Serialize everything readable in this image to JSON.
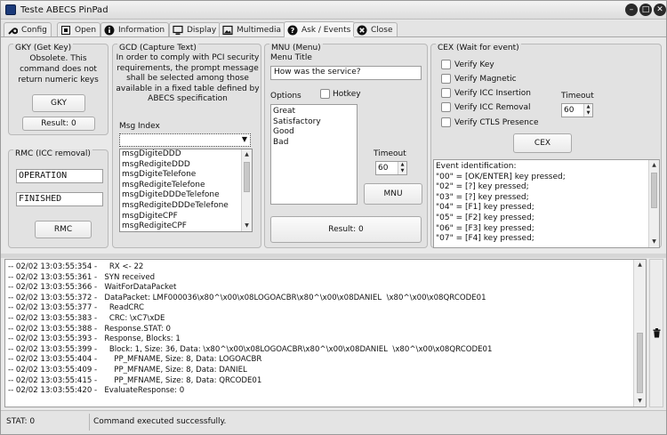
{
  "window": {
    "title": "Teste ABECS PinPad"
  },
  "tabs": [
    {
      "label": "Config",
      "icon": "wrench-icon"
    },
    {
      "label": "Open",
      "icon": "open-port-icon"
    },
    {
      "label": "Information",
      "icon": "info-icon"
    },
    {
      "label": "Display",
      "icon": "monitor-icon"
    },
    {
      "label": "Multimedia",
      "icon": "image-icon"
    },
    {
      "label": "Ask / Events",
      "icon": "help-icon",
      "active": true
    },
    {
      "label": "Close",
      "icon": "close-circle-icon"
    }
  ],
  "gky": {
    "title": "GKY (Get Key)",
    "description": "Obsolete. This command does not return numeric keys",
    "button": "GKY",
    "result": "Result: 0"
  },
  "rmc": {
    "title": "RMC (ICC removal)",
    "line1": "OPERATION",
    "line2": "FINISHED",
    "button": "RMC"
  },
  "gcd": {
    "title": "GCD (Capture Text)",
    "description": "In order to comply with PCI security requirements, the prompt message shall be selected among those available in a fixed table defined by ABECS specification",
    "msg_index_label": "Msg Index",
    "msg_items": [
      "msgDigiteDDD",
      "msgRedigiteDDD",
      "msgDigiteTelefone",
      "msgRedigiteTelefone",
      "msgDigiteDDDeTelefone",
      "msgRedigiteDDDeTelefone",
      "msgDigiteCPF",
      "msgRedigiteCPF"
    ]
  },
  "mnu": {
    "title": "MNU (Menu)",
    "menu_title_label": "Menu Title",
    "menu_title_value": "How was the service?",
    "options_label": "Options",
    "hotkey_label": "Hotkey",
    "options": [
      "Great",
      "Satisfactory",
      "Good",
      "Bad"
    ],
    "timeout_label": "Timeout",
    "timeout_value": "60",
    "button": "MNU",
    "result": "Result: 0"
  },
  "cex": {
    "title": "CEX (Wait for event)",
    "checks": [
      "Verify Key",
      "Verify Magnetic",
      "Verify ICC Insertion",
      "Verify ICC Removal",
      "Verify CTLS Presence"
    ],
    "timeout_label": "Timeout",
    "timeout_value": "60",
    "button": "CEX",
    "events": [
      "Event identification:",
      "\"00\" = [OK/ENTER] key pressed;",
      "\"02\" = [?] key pressed;",
      "\"03\" = [?] key pressed;",
      "\"04\" = [F1] key pressed;",
      "\"05\" = [F2] key pressed;",
      "\"06\" = [F3] key pressed;",
      "\"07\" = [F4] key pressed;"
    ]
  },
  "log": {
    "lines": [
      "-- 02/02 13:03:55:354 -     RX <- 22",
      "-- 02/02 13:03:55:361 -   SYN received",
      "-- 02/02 13:03:55:366 -   WaitForDataPacket",
      "-- 02/02 13:03:55:372 -   DataPacket: LMF000036\\x80^\\x00\\x08LOGOACBR\\x80^\\x00\\x08DANIEL  \\x80^\\x00\\x08QRCODE01",
      "-- 02/02 13:03:55:377 -     ReadCRC",
      "-- 02/02 13:03:55:383 -     CRC: \\xC7\\xDE",
      "-- 02/02 13:03:55:388 -   Response.STAT: 0",
      "-- 02/02 13:03:55:393 -   Response, Blocks: 1",
      "-- 02/02 13:03:55:399 -     Block: 1, Size: 36, Data: \\x80^\\x00\\x08LOGOACBR\\x80^\\x00\\x08DANIEL  \\x80^\\x00\\x08QRCODE01",
      "-- 02/02 13:03:55:404 -       PP_MFNAME, Size: 8, Data: LOGOACBR",
      "-- 02/02 13:03:55:409 -       PP_MFNAME, Size: 8, Data: DANIEL",
      "-- 02/02 13:03:55:415 -       PP_MFNAME, Size: 8, Data: QRCODE01",
      "-- 02/02 13:03:55:420 -   EvaluateResponse: 0"
    ]
  },
  "status": {
    "stat": "STAT: 0",
    "message": "Command executed successfully."
  }
}
